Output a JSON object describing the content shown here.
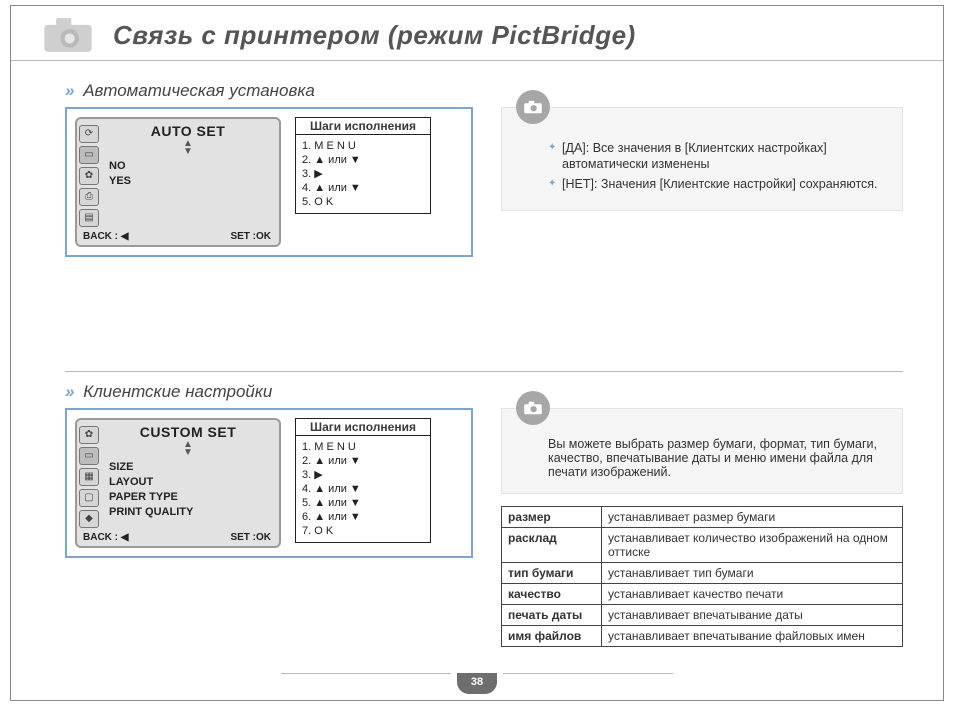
{
  "header": {
    "title": "Связь с принтером (режим PictBridge)"
  },
  "sectionA": {
    "heading": "Автоматическая установка",
    "lcd": {
      "title": "AUTO  SET",
      "items": [
        "NO",
        "YES"
      ],
      "back": "BACK :",
      "set": "SET :OK"
    },
    "stepsHead": "Шаги исполнения",
    "steps": {
      "s1": "1. M E N U",
      "s2": "2. ▲ или ▼",
      "s3": "3. ▶",
      "s4": "4. ▲ или ▼",
      "s5": "5. O K"
    },
    "info": {
      "b1": "[ДА]: Все значения в [Клиентских настройках] автоматически изменены",
      "b2": "[НЕТ]: Значения [Клиентские настройки] сохраняются."
    }
  },
  "sectionB": {
    "heading": "Клиентские настройки",
    "lcd": {
      "title": "CUSTOM  SET",
      "items": [
        "SIZE",
        "LAYOUT",
        "PAPER  TYPE",
        "PRINT  QUALITY"
      ],
      "back": "BACK :",
      "set": "SET :OK"
    },
    "stepsHead": "Шаги исполнения",
    "steps": {
      "s1": "1. M E N U",
      "s2": "2. ▲ или ▼",
      "s3": "3. ▶",
      "s4": "4. ▲ или ▼",
      "s5": "5. ▲ или ▼",
      "s6": "6. ▲ или ▼",
      "s7": "7. O K"
    },
    "infoText": "Вы можете выбрать размер бумаги, формат, тип бумаги, качество, впечатывание даты и меню имени файла для печати изображений.",
    "table": {
      "r1k": "размер",
      "r1v": "устанавливает размер бумаги",
      "r2k": "расклад",
      "r2v": "устанавливает количество изображений на одном оттиске",
      "r3k": "тип бумаги",
      "r3v": "устанавливает тип бумаги",
      "r4k": "качество",
      "r4v": "устанавливает качество печати",
      "r5k": "печать даты",
      "r5v": "устанавливает впечатывание даты",
      "r6k": "имя файлов",
      "r6v": "устанавливает впечатывание файловых имен"
    }
  },
  "pageNumber": "38"
}
